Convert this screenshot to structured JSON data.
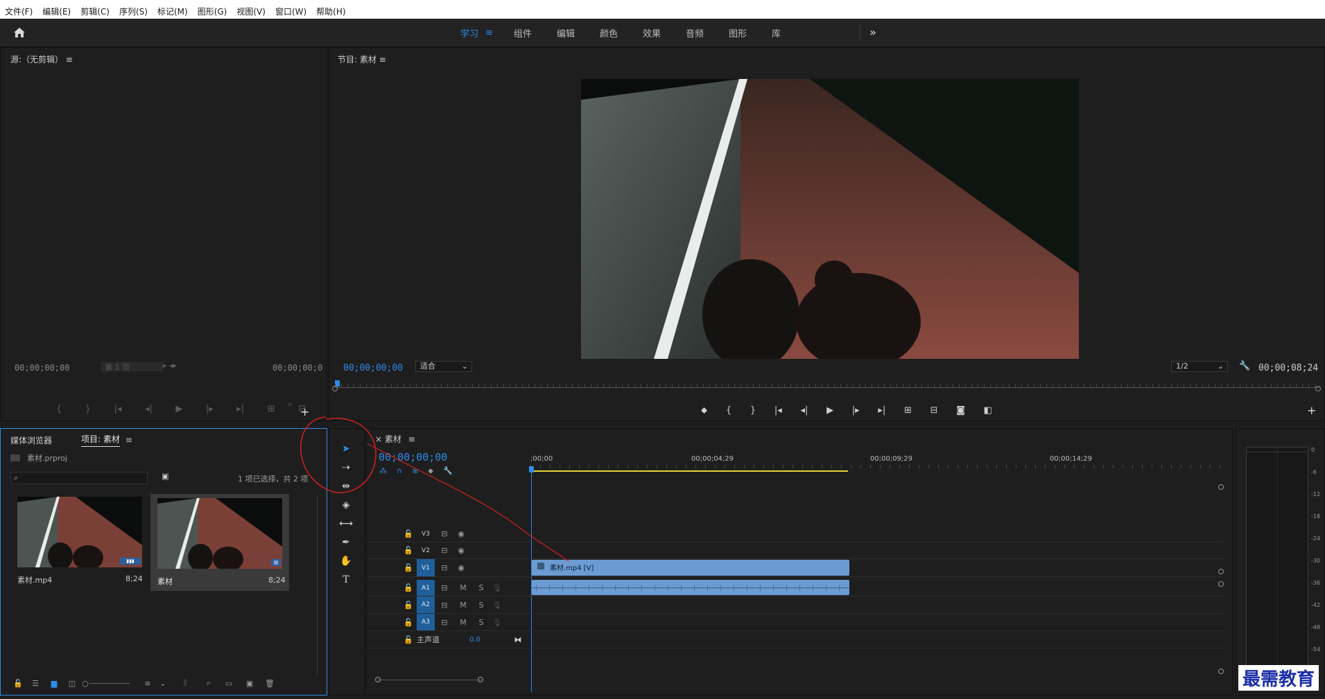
{
  "menu": [
    "文件(F)",
    "编辑(E)",
    "剪辑(C)",
    "序列(S)",
    "标记(M)",
    "图形(G)",
    "视图(V)",
    "窗口(W)",
    "帮助(H)"
  ],
  "workspaces": {
    "tabs": [
      "学习",
      "组件",
      "编辑",
      "颜色",
      "效果",
      "音频",
      "图形",
      "库"
    ],
    "active": "学习",
    "more": "»"
  },
  "source": {
    "title": "源:（无剪辑）",
    "tc_in": "00;00;00;00",
    "page": "第 1 页",
    "tc_out": "00;00;00;0"
  },
  "program": {
    "title": "节目: 素材",
    "timecode": "00;00;00;00",
    "fit": "适合",
    "resolution": "1/2",
    "duration": "00;00;08;24"
  },
  "project": {
    "tabs": [
      "媒体浏览器",
      "项目: 素材"
    ],
    "active_tab": "项目: 素材",
    "file": "素材.prproj",
    "search_placeholder": "",
    "selection": "1 项已选择，共 2 项",
    "items": [
      {
        "name": "素材.mp4",
        "duration": "8;24"
      },
      {
        "name": "素材",
        "duration": "8;24"
      }
    ]
  },
  "timeline": {
    "title": "素材",
    "timecode": "00;00;00;00",
    "ruler": [
      ";00;00",
      "00;00;04;29",
      "00;00;09;29",
      "00;00;14;29"
    ],
    "video_tracks": [
      "V3",
      "V2",
      "V1"
    ],
    "audio_tracks": [
      "A1",
      "A2",
      "A3"
    ],
    "master": "主声道",
    "master_value": "0.0",
    "clip": "素材.mp4 [V]",
    "mute": "M",
    "solo": "S"
  },
  "meter": {
    "scale": [
      "0",
      "-6",
      "-12",
      "-18",
      "-24",
      "-30",
      "-36",
      "-42",
      "-48",
      "-54"
    ]
  },
  "watermark": "最需教育",
  "colors": {
    "accent": "#2d8ceb",
    "clip": "#6b9bd2",
    "annotation": "#d42020"
  }
}
